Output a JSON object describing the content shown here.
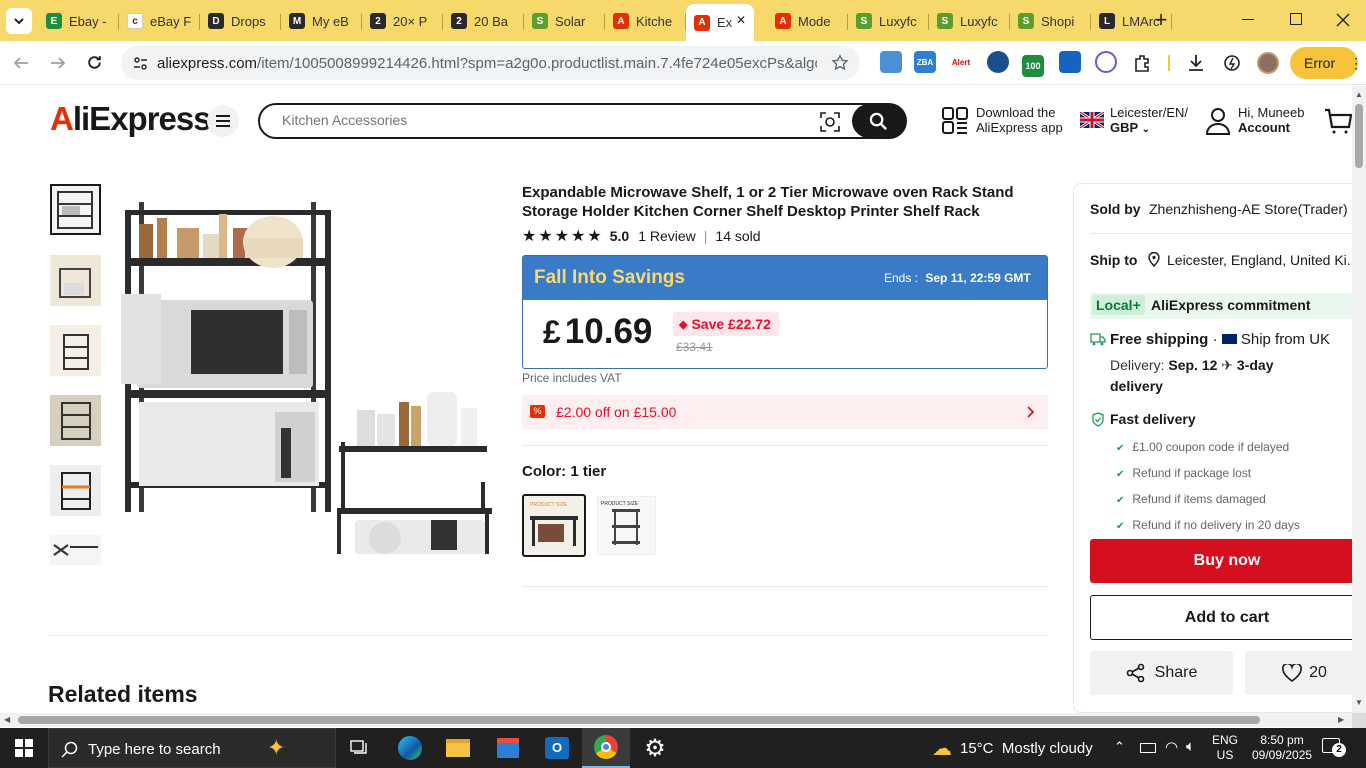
{
  "browser": {
    "tabs": [
      {
        "label": "Ebay -",
        "fav": "E",
        "color": "#1e8e3e"
      },
      {
        "label": "eBay F",
        "fav": "c",
        "color": "#ffffff"
      },
      {
        "label": "Drops",
        "fav": "D",
        "color": "#2a2a2a"
      },
      {
        "label": "My eB",
        "fav": "M",
        "color": "#2a2a2a"
      },
      {
        "label": "20× P",
        "fav": "2",
        "color": "#2a2a2a"
      },
      {
        "label": "20 Ba",
        "fav": "2",
        "color": "#2a2a2a"
      },
      {
        "label": "Solar",
        "fav": "S",
        "color": "#5c9d2b"
      },
      {
        "label": "Kitche",
        "fav": "A",
        "color": "#e62e04"
      },
      {
        "label": "Ex",
        "fav": "A",
        "color": "#e62e04"
      },
      {
        "label": "Mode",
        "fav": "A",
        "color": "#e62e04"
      },
      {
        "label": "Luxyfc",
        "fav": "S",
        "color": "#5c9d2b"
      },
      {
        "label": "Luxyfc",
        "fav": "S",
        "color": "#5c9d2b"
      },
      {
        "label": "Shopi",
        "fav": "S",
        "color": "#5c9d2b"
      },
      {
        "label": "LMArc",
        "fav": "L",
        "color": "#2a2a2a"
      }
    ],
    "new_tab_label": "+",
    "url_domain": "aliexpress.com",
    "url_rest": "/item/1005008999214426.html?spm=a2g0o.productlist.main.7.4fe724e05excPs&algo_pvid...",
    "error_label": "Error",
    "ext_badge": "100",
    "ext_alert": "Alert"
  },
  "site": {
    "logo_a": "A",
    "logo_rest": "liExpress",
    "search_placeholder": "Kitchen Accessories",
    "download_line1": "Download the",
    "download_line2": "AliExpress app",
    "locale_line1": "Leicester/EN/",
    "locale_line2": "GBP",
    "account_line1": "Hi, Muneeb",
    "account_line2": "Account"
  },
  "product": {
    "title": "Expandable Microwave Shelf, 1 or 2 Tier Microwave oven Rack Stand Storage Holder Kitchen Corner Shelf Desktop Printer Shelf Rack",
    "rating": "5.0",
    "reviews": "1 Review",
    "sold": "14 sold",
    "promo_name": "Fall Into Savings",
    "ends_label": "Ends :",
    "ends_value": "Sep 11, 22:59 GMT",
    "currency": "£",
    "price": "10.69",
    "save_text": "Save £22.72",
    "original_price": "£33.41",
    "vat_note": "Price includes VAT",
    "coupon_text": "£2.00 off on £15.00",
    "color_label": "Color: 1 tier",
    "related_heading": "Related items"
  },
  "sidebar": {
    "sold_by_label": "Sold by",
    "store": "Zhenzhisheng-AE Store(Trader)",
    "ship_to_label": "Ship to",
    "ship_to": "Leicester, England, United Ki...",
    "local_badge": "Local+",
    "commitment": "AliExpress commitment",
    "free_shipping": "Free shipping",
    "ship_from": "Ship from UK",
    "delivery_prefix": "Delivery:",
    "delivery_date": "Sep. 12",
    "delivery_speed": "3-day",
    "delivery_word": "delivery",
    "fast_delivery": "Fast delivery",
    "guarantees": [
      "£1.00 coupon code if delayed",
      "Refund if package lost",
      "Refund if items damaged",
      "Refund if no delivery in 20 days"
    ],
    "buy_now": "Buy now",
    "add_to_cart": "Add to cart",
    "share": "Share",
    "wishlist_count": "20"
  },
  "taskbar": {
    "search_placeholder": "Type here to search",
    "weather": "15°C  Mostly cloudy",
    "lang1": "ENG",
    "lang2": "US",
    "time": "8:50 pm",
    "date": "09/09/2025",
    "notif_count": "2"
  }
}
